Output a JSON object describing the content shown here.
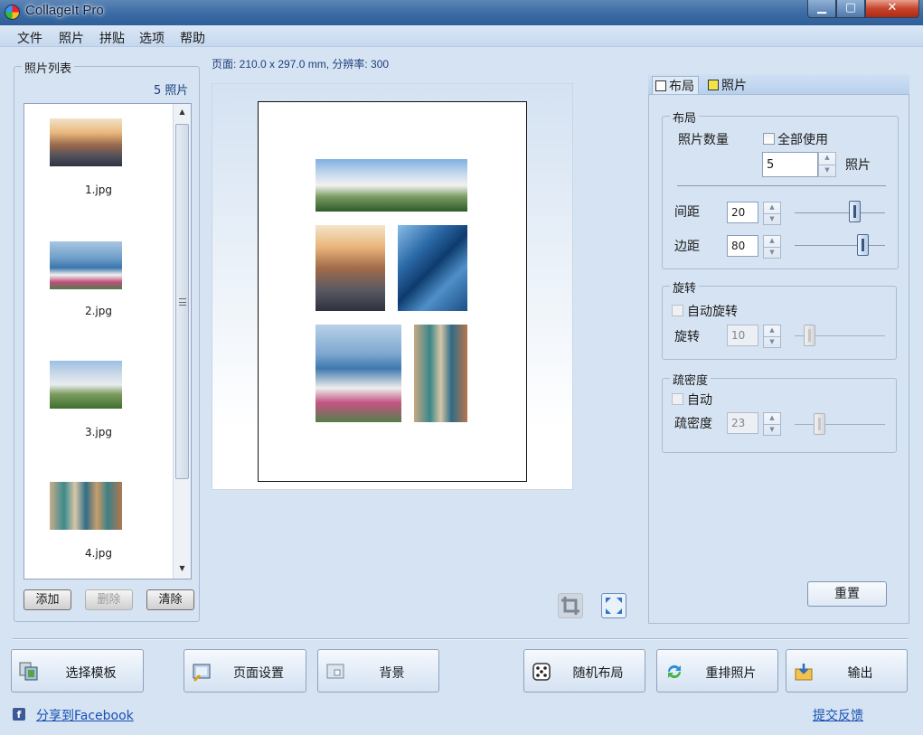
{
  "window": {
    "title": "CollageIt Pro",
    "min": "▁",
    "max": "▢",
    "close": "✕"
  },
  "menu": [
    "文件",
    "照片",
    "拼贴",
    "选项",
    "帮助"
  ],
  "photo_list": {
    "title": "照片列表",
    "count": "5 照片",
    "items": [
      "1.jpg",
      "2.jpg",
      "3.jpg",
      "4.jpg"
    ],
    "buttons": {
      "add": "添加",
      "delete": "删除",
      "clear": "清除"
    }
  },
  "page_info": "页面: 210.0 x 297.0 mm, 分辨率: 300",
  "tabs": {
    "layout": "布局",
    "photo": "照片"
  },
  "layout_group": {
    "title": "布局",
    "photo_count_label": "照片数量",
    "use_all_label": "全部使用",
    "photo_count_value": "5",
    "photo_unit": "照片",
    "spacing_label": "间距",
    "spacing_value": "20",
    "margin_label": "边距",
    "margin_value": "80"
  },
  "rotation_group": {
    "title": "旋转",
    "auto_label": "自动旋转",
    "rotation_label": "旋转",
    "rotation_value": "10"
  },
  "density_group": {
    "title": "疏密度",
    "auto_label": "自动",
    "density_label": "疏密度",
    "density_value": "23"
  },
  "reset_label": "重置",
  "bottom_buttons": {
    "template": "选择模板",
    "page_setup": "页面设置",
    "background": "背景",
    "random_layout": "随机布局",
    "shuffle": "重排照片",
    "output": "输出"
  },
  "share_link": "分享到Facebook",
  "feedback_link": "提交反馈"
}
